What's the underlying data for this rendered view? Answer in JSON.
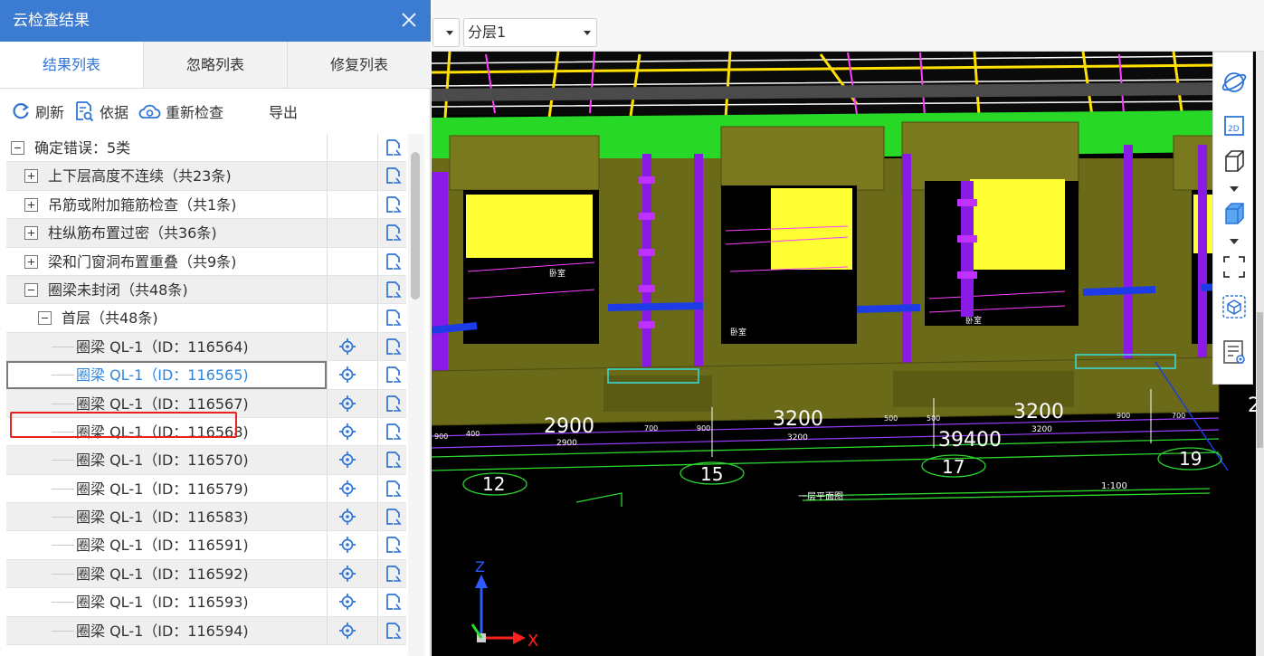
{
  "panel": {
    "title": "云检查结果",
    "tabs": [
      {
        "label": "结果列表",
        "active": true
      },
      {
        "label": "忽略列表",
        "active": false
      },
      {
        "label": "修复列表",
        "active": false
      }
    ],
    "toolbar": {
      "refresh": "刷新",
      "basis": "依据",
      "recheck": "重新检查",
      "export": "导出"
    },
    "tree": {
      "root": "确定错误：5类",
      "categories": [
        "上下层高度不连续（共23条)",
        "吊筋或附加箍筋检查（共1条)",
        "柱纵筋布置过密（共36条)",
        "梁和门窗洞布置重叠（共9条)",
        "圈梁未封闭（共48条)"
      ],
      "floor": "首层（共48条)",
      "items": [
        "圈梁 QL-1（ID：116564)",
        "圈梁 QL-1（ID：116565)",
        "圈梁 QL-1（ID：116567)",
        "圈梁 QL-1（ID：116568)",
        "圈梁 QL-1（ID：116570)",
        "圈梁 QL-1（ID：116579)",
        "圈梁 QL-1（ID：116583)",
        "圈梁 QL-1（ID：116591)",
        "圈梁 QL-1（ID：116592)",
        "圈梁 QL-1（ID：116593)",
        "圈梁 QL-1（ID：116594)"
      ]
    }
  },
  "viewport": {
    "layer_select": "分层1",
    "dims": {
      "d1": "2900",
      "d2": "3200",
      "d3": "3200",
      "total": "39400",
      "d1_small": "2900",
      "d2_small": "3200",
      "d3_small": "3200",
      "seg_a": "900",
      "seg_b": "400",
      "seg_c": "700",
      "seg_d": "900",
      "seg_e": "500",
      "seg_f": "500",
      "seg_g": "900",
      "seg_h": "700",
      "seg_edge": "2"
    },
    "axes": [
      "12",
      "15",
      "17",
      "19"
    ],
    "plan_title": "一层平面图",
    "scale": "1:100",
    "room_label": "卧室",
    "axis_x": "X",
    "axis_z": "Z"
  },
  "colors": {
    "header": "#3b7bd1",
    "wall": "#6b6a18",
    "slab": "#27d827",
    "window": "#ffff33",
    "column": "#8a1be6",
    "beam": "#1e3ce6",
    "selected_text": "#2e86de",
    "highlight": "#e8211d"
  }
}
